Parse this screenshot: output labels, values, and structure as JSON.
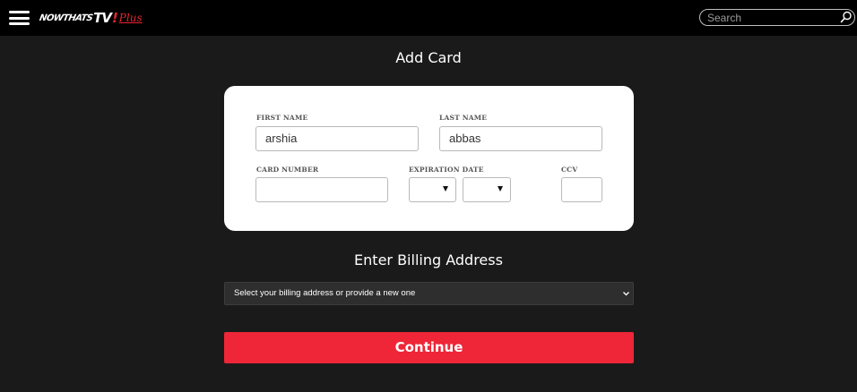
{
  "header": {
    "logo": {
      "brand": "NOWTHATS",
      "tv": "TV",
      "exclam": "!",
      "plus": "Plus"
    },
    "search": {
      "placeholder": "Search"
    }
  },
  "add_card": {
    "title": "Add Card",
    "first_name": {
      "label": "FIRST NAME",
      "value": "arshia"
    },
    "last_name": {
      "label": "LAST NAME",
      "value": "abbas"
    },
    "card_number": {
      "label": "CARD NUMBER",
      "value": ""
    },
    "expiration": {
      "label": "EXPIRATION DATE",
      "month": "",
      "year": ""
    },
    "ccv": {
      "label": "CCV",
      "value": ""
    }
  },
  "billing": {
    "title": "Enter Billing Address",
    "select_text": "Select your billing address or provide a new one"
  },
  "continue_label": "Continue",
  "colors": {
    "accent": "#ee2637",
    "background": "#1a1a1a",
    "topbar": "#000000"
  }
}
